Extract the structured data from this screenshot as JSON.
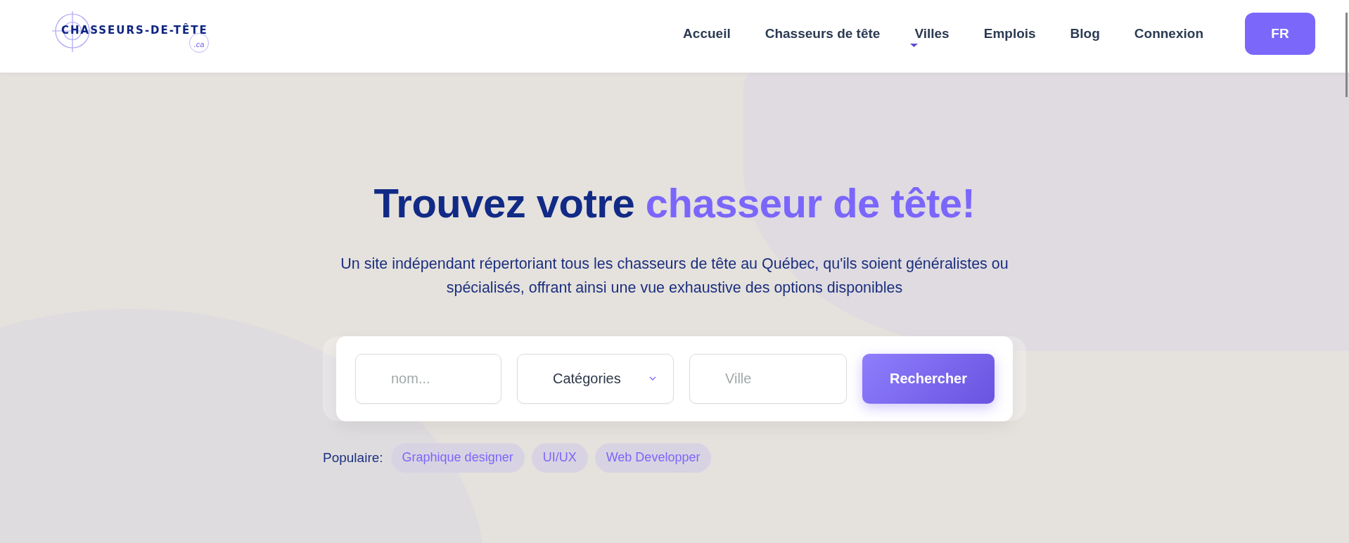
{
  "header": {
    "logo": {
      "name": "CHASSEURS-DE-TÊTE",
      "suffix": ".ca"
    },
    "nav": [
      {
        "label": "Accueil",
        "dropdown": false
      },
      {
        "label": "Chasseurs de tête",
        "dropdown": false
      },
      {
        "label": "Villes",
        "dropdown": true
      },
      {
        "label": "Emplois",
        "dropdown": false
      },
      {
        "label": "Blog",
        "dropdown": false
      },
      {
        "label": "Connexion",
        "dropdown": false
      }
    ],
    "language_button": "FR"
  },
  "hero": {
    "title": {
      "text": "Trouvez votre",
      "highlight": "chasseur de tête!"
    },
    "subtitle": "Un site indépendant répertoriant tous les chasseurs de tête au Québec, qu'ils soient généralistes ou spécialisés, offrant ainsi une vue exhaustive des options disponibles",
    "search": {
      "name_field": {
        "placeholder": "nom..."
      },
      "category_select": {
        "value": "Catégories"
      },
      "city_field": {
        "placeholder": "Ville"
      },
      "button": "Rechercher"
    },
    "popular": {
      "label": "Populaire:",
      "tags": [
        {
          "label": "Graphique designer"
        },
        {
          "label": "UI/UX"
        },
        {
          "label": "Web Developper"
        }
      ]
    }
  }
}
